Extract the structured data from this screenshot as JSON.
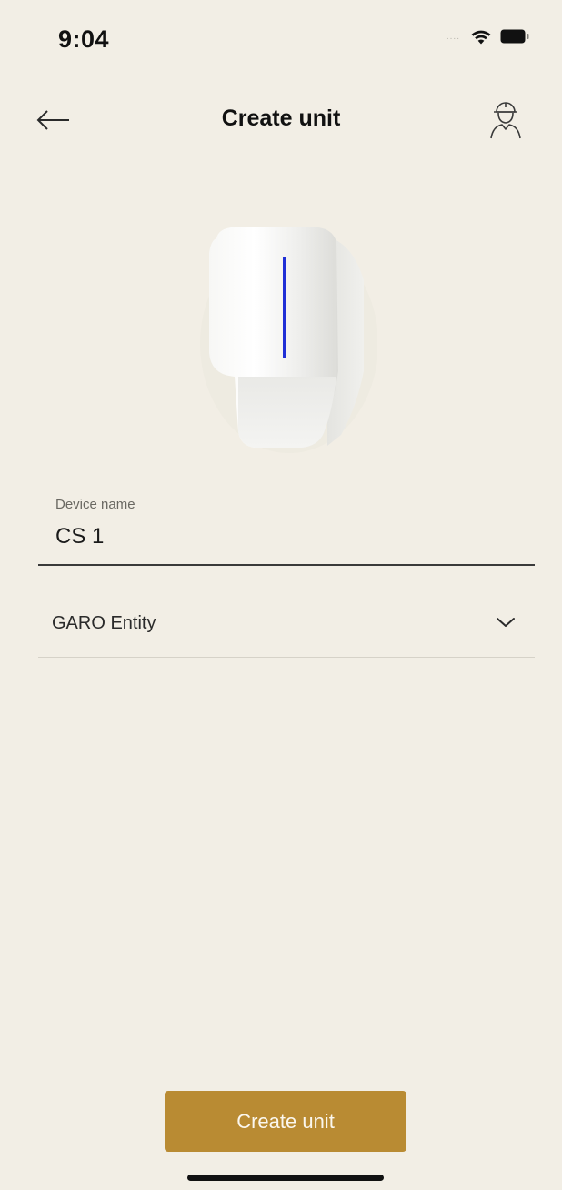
{
  "status_bar": {
    "time": "9:04",
    "signal_dots": "....",
    "icons": [
      "wifi-icon",
      "battery-icon"
    ]
  },
  "nav": {
    "title": "Create unit",
    "back_icon": "arrow-left-icon",
    "profile_icon": "installer-helmet-icon"
  },
  "device_image": {
    "description_icon": "charging-station-device",
    "led_color": "#1f2fd6"
  },
  "form": {
    "device_name": {
      "label": "Device name",
      "value": "CS 1"
    },
    "entity_select": {
      "selected": "GARO Entity",
      "icon": "chevron-down-icon"
    }
  },
  "actions": {
    "create_label": "Create unit"
  },
  "colors": {
    "background": "#f2eee5",
    "accent": "#b98b33",
    "button_text": "#fbf7ee"
  }
}
